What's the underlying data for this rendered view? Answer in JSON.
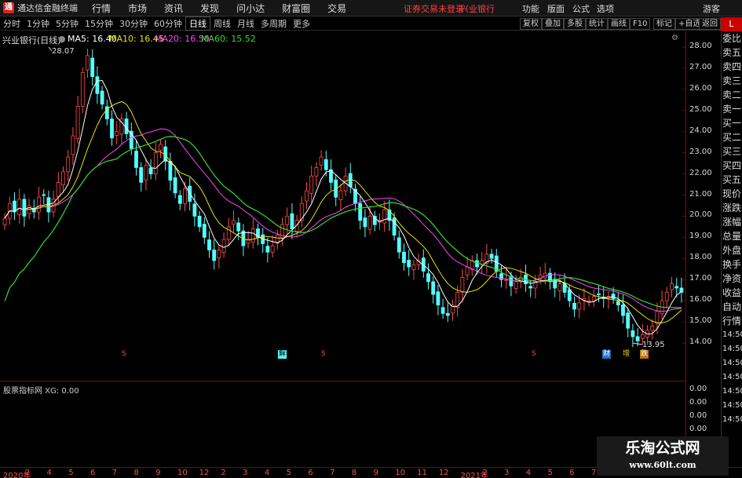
{
  "menubar": {
    "app_name": "通达信金融终端",
    "items": [
      "行情",
      "市场",
      "资讯",
      "发现",
      "问小达",
      "财富圈",
      "交易"
    ],
    "notice": "证券交易未登录",
    "stock": "兴业银行",
    "right_items": [
      "功能",
      "版面",
      "公式",
      "选项",
      "游客"
    ]
  },
  "tabs": [
    "分时",
    "1分钟",
    "5分钟",
    "15分钟",
    "30分钟",
    "60分钟",
    "日线",
    "周线",
    "月线",
    "多周期",
    "更多"
  ],
  "active_tab": "日线",
  "tools": [
    "复权",
    "叠加",
    "多股",
    "统计",
    "画线",
    "F10",
    "标记",
    "+自选",
    "返回"
  ],
  "corner_badge": "L",
  "chart_header": {
    "title": "兴业银行(日线)",
    "ma5": "MA5: 16.40",
    "ma10": "MA10: 16.45",
    "ma20": "MA20: 16.50",
    "ma60": "MA60: 15.52"
  },
  "annotations": {
    "high": "28.07",
    "low": "13.95"
  },
  "events": [
    {
      "label": "S"
    },
    {
      "label": "解"
    },
    {
      "label": "S"
    },
    {
      "label": "S"
    },
    {
      "label": "财"
    },
    {
      "label": "增"
    },
    {
      "label": "跌"
    }
  ],
  "right_panel": [
    "委比",
    "卖五",
    "卖四",
    "卖三",
    "卖二",
    "卖一",
    "买一",
    "买二",
    "买三",
    "买四",
    "买五",
    "现价",
    "涨跌",
    "涨幅",
    "总量",
    "外盘",
    "换手",
    "净资",
    "收益",
    "自动",
    "行情",
    "14:50",
    "14:50",
    "14:50",
    "14:50",
    "14:50",
    "14:50",
    "14:50"
  ],
  "sub_chart": {
    "label": "股票指标网 XG: 0.00"
  },
  "date_axis": [
    "2020年",
    "2",
    "4",
    "5",
    "6",
    "7",
    "8",
    "9",
    "10",
    "12",
    "2",
    "3",
    "4",
    "5",
    "6",
    "7",
    "8",
    "9",
    "10",
    "11",
    "12",
    "2021年",
    "2",
    "3",
    "4",
    "5",
    "6",
    "7",
    "8",
    "9",
    "10"
  ],
  "watermark": {
    "line1": "乐淘公式网",
    "line2": "www.60lt.com"
  },
  "colors": {
    "ma5": "#ffffff",
    "ma10": "#e6e600",
    "ma20": "#ff44ff",
    "ma60": "#33dd33",
    "up": "#ff4a4a",
    "down": "#54ffff",
    "bg": "#000000"
  },
  "chart_data": {
    "type": "candlestick",
    "ylim": [
      13.5,
      28.5
    ],
    "y_ticks": [
      28.0,
      27.0,
      26.0,
      25.0,
      24.0,
      23.0,
      22.0,
      21.0,
      20.0,
      19.0,
      18.0,
      17.0,
      16.0,
      15.0,
      14.0
    ],
    "close": [
      19.9,
      20.6,
      20.2,
      20.8,
      20.0,
      20.5,
      20.2,
      20.9,
      21.0,
      20.2,
      20.8,
      21.6,
      22.1,
      22.8,
      23.8,
      25.2,
      26.8,
      27.6,
      26.6,
      25.8,
      25.3,
      24.6,
      23.7,
      24.0,
      24.6,
      23.9,
      23.2,
      22.3,
      21.6,
      22.4,
      22.0,
      23.0,
      23.4,
      22.6,
      21.7,
      21.1,
      20.6,
      21.3,
      20.7,
      20.0,
      19.5,
      19.0,
      18.4,
      17.9,
      18.4,
      18.9,
      19.5,
      19.8,
      19.3,
      18.6,
      18.9,
      19.4,
      19.0,
      18.7,
      18.3,
      18.6,
      19.1,
      19.6,
      20.0,
      19.4,
      19.8,
      20.6,
      21.2,
      21.9,
      22.3,
      22.8,
      22.2,
      21.6,
      20.9,
      21.2,
      21.9,
      21.4,
      20.6,
      19.8,
      19.5,
      20.0,
      19.6,
      19.8,
      20.3,
      19.8,
      19.1,
      18.3,
      17.8,
      17.6,
      17.7,
      17.9,
      17.4,
      16.9,
      16.3,
      15.8,
      15.4,
      15.3,
      15.8,
      16.4,
      17.1,
      17.6,
      17.9,
      17.6,
      17.9,
      18.2,
      18.0,
      17.4,
      17.0,
      17.0,
      16.7,
      16.9,
      17.1,
      16.8,
      16.6,
      16.9,
      17.2,
      17.3,
      16.9,
      16.6,
      16.8,
      16.4,
      16.0,
      15.6,
      15.9,
      16.1,
      16.0,
      16.2,
      16.3,
      16.1,
      16.2,
      16.1,
      15.8,
      15.3,
      14.7,
      14.3,
      14.1,
      14.4,
      14.6,
      14.8,
      15.5,
      16.0,
      16.4,
      16.8,
      16.6,
      16.4
    ]
  }
}
